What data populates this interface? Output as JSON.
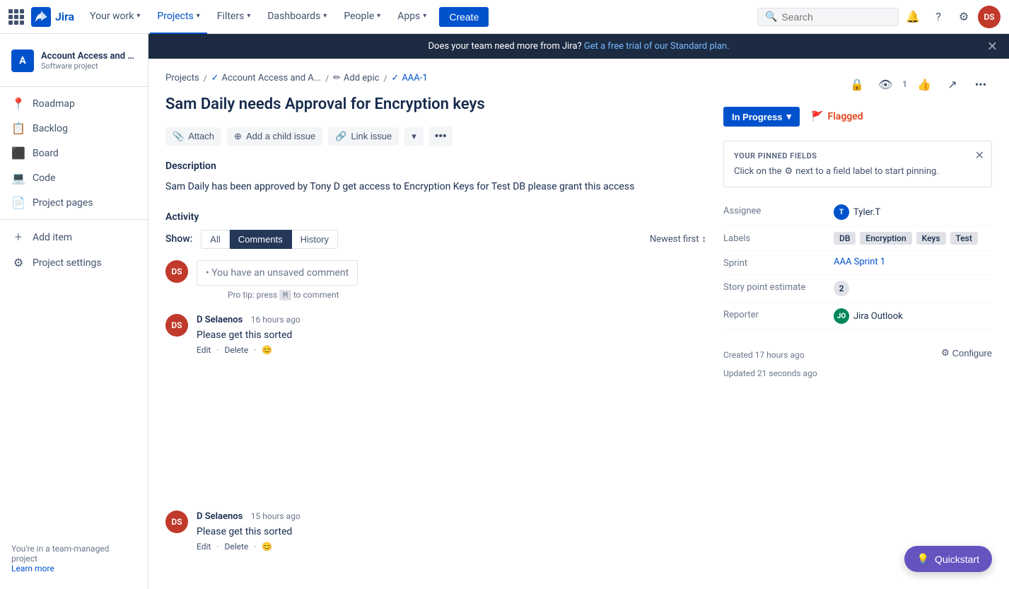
{
  "topnav": {
    "logo_text": "Jira",
    "your_work": "Your work",
    "projects": "Projects",
    "filters": "Filters",
    "dashboards": "Dashboards",
    "people": "People",
    "apps": "Apps",
    "create": "Create",
    "search_placeholder": "Search",
    "user_initials": "DS"
  },
  "sidebar": {
    "project_icon": "A",
    "project_name": "Account Access and Ap...",
    "project_type": "Software project",
    "items": [
      {
        "label": "Roadmap",
        "icon": "📍"
      },
      {
        "label": "Backlog",
        "icon": "📋"
      },
      {
        "label": "Board",
        "icon": "⬛"
      },
      {
        "label": "Code",
        "icon": "💻"
      },
      {
        "label": "Project pages",
        "icon": "📄"
      },
      {
        "label": "Add item",
        "icon": "+"
      },
      {
        "label": "Project settings",
        "icon": "⚙"
      }
    ],
    "footer_text": "You're in a team-managed project",
    "footer_link": "Learn more"
  },
  "banner": {
    "text": "Does your team need more from Jira?",
    "link_text": "Get a free trial of our Standard plan."
  },
  "breadcrumb": {
    "projects": "Projects",
    "project": "Account Access and A...",
    "epic": "Add epic",
    "issue": "AAA-1"
  },
  "issue": {
    "title": "Sam Daily needs Approval for Encryption keys",
    "status": "In Progress",
    "flagged": "Flagged",
    "toolbar": {
      "attach": "Attach",
      "add_child": "Add a child issue",
      "link_issue": "Link issue"
    },
    "description_title": "Description",
    "description": "Sam Daily has been approved by Tony D  get access to Encryption Keys for Test DB please grant this access",
    "activity": {
      "title": "Activity",
      "show_label": "Show:",
      "tabs": [
        "All",
        "Comments",
        "History"
      ],
      "active_tab": "Comments",
      "sort": "Newest first"
    },
    "comments": [
      {
        "author": "D Selaenos",
        "time": "16 hours ago",
        "text": "Please get this sorted",
        "initials": "DS"
      },
      {
        "author": "D Selaenos",
        "time": "15 hours ago",
        "text": "Please get this sorted",
        "initials": "DS"
      }
    ],
    "unsaved_comment": "• You have an unsaved comment",
    "pro_tip": "Pro tip: press",
    "pro_tip_key": "M",
    "pro_tip_suffix": "to comment"
  },
  "right_panel": {
    "pinned_title": "YOUR PINNED FIELDS",
    "pinned_text": "Click on the",
    "pinned_icon": "⚙",
    "pinned_suffix": "next to a field label to start pinning.",
    "assignee_label": "Assignee",
    "assignee_value": "Tyler.T",
    "assignee_initials": "T",
    "labels_label": "Labels",
    "labels": [
      "DB",
      "Encryption",
      "Keys",
      "Test"
    ],
    "sprint_label": "Sprint",
    "sprint_value": "AAA Sprint 1",
    "story_label": "Story point estimate",
    "story_value": "2",
    "reporter_label": "Reporter",
    "reporter_value": "Jira Outlook",
    "reporter_initials": "JO",
    "created": "Created 17 hours ago",
    "updated": "Updated 21 seconds ago",
    "configure": "Configure"
  },
  "quickstart": "Quickstart"
}
